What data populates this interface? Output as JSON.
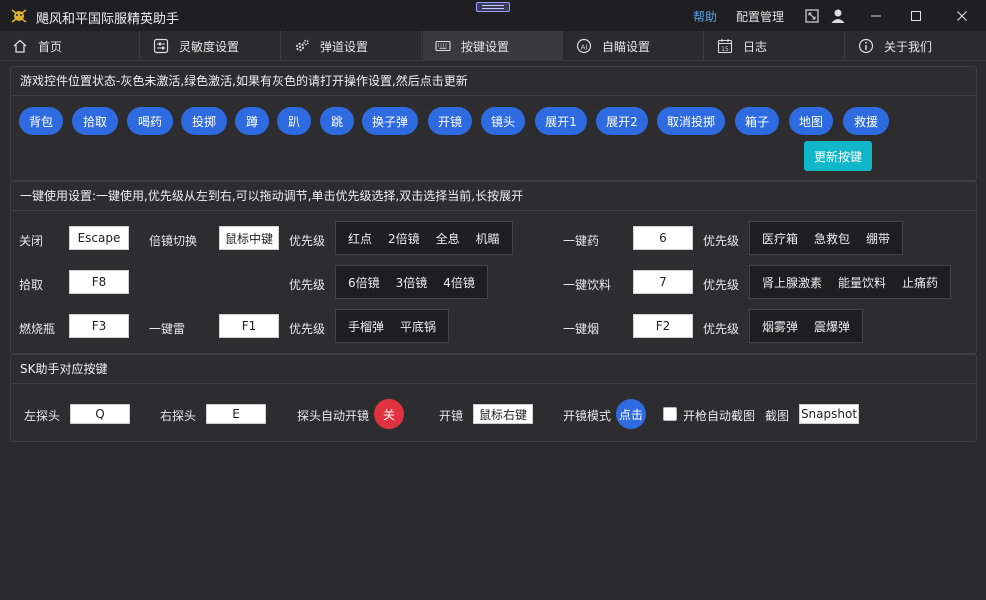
{
  "window": {
    "title": "飓风和平国际服精英助手",
    "help": "帮助",
    "config": "配置管理"
  },
  "tabs": [
    {
      "label": "首页",
      "icon": "home-icon"
    },
    {
      "label": "灵敏度设置",
      "icon": "sliders-icon"
    },
    {
      "label": "弹道设置",
      "icon": "gears-icon"
    },
    {
      "label": "按键设置",
      "icon": "keyboard-icon",
      "active": true
    },
    {
      "label": "自瞄设置",
      "icon": "ai-target-icon"
    },
    {
      "label": "日志",
      "icon": "calendar-icon"
    },
    {
      "label": "关于我们",
      "icon": "info-icon"
    }
  ],
  "control_state": {
    "title": "游戏控件位置状态-灰色未激活,绿色激活,如果有灰色的请打开操作设置,然后点击更新",
    "buttons": [
      "背包",
      "拾取",
      "喝药",
      "投掷",
      "蹲",
      "趴",
      "跳",
      "换子弹",
      "开镜",
      "镜头",
      "展开1",
      "展开2",
      "取消投掷",
      "箱子",
      "地图",
      "救援"
    ],
    "update_button": "更新按键"
  },
  "one_key": {
    "title": "一键使用设置:一键使用,优先级从左到右,可以拖动调节,单击优先级选择,双击选择当前,长按展开",
    "close_label": "关闭",
    "close_key": "Escape",
    "zoom_switch_label": "倍镜切换",
    "zoom_switch_key": "鼠标中键",
    "priority_label": "优先级",
    "scope_priority_1": [
      "红点",
      "2倍镜",
      "全息",
      "机瞄"
    ],
    "pickup_label": "拾取",
    "pickup_key": "F8",
    "scope_priority_2": [
      "6倍镜",
      "3倍镜",
      "4倍镜"
    ],
    "molotov_label": "燃烧瓶",
    "molotov_key": "F3",
    "grenade_label": "一键雷",
    "grenade_key": "F1",
    "throw_priority": [
      "手榴弹",
      "平底锅"
    ],
    "med_label": "一键药",
    "med_key": "6",
    "med_priority": [
      "医疗箱",
      "急救包",
      "绷带"
    ],
    "drink_label": "一键饮料",
    "drink_key": "7",
    "drink_priority": [
      "肾上腺激素",
      "能量饮料",
      "止痛药"
    ],
    "smoke_label": "一键烟",
    "smoke_key": "F2",
    "smoke_priority": [
      "烟雾弹",
      "震爆弹"
    ]
  },
  "sk": {
    "title": "SK助手对应按键",
    "lean_left_label": "左探头",
    "lean_left_key": "Q",
    "lean_right_label": "右探头",
    "lean_right_key": "E",
    "auto_scope_label": "探头自动开镜",
    "auto_scope_state": "关",
    "auto_scope_color": "#e0323f",
    "scope_label": "开镜",
    "scope_key": "鼠标右键",
    "scope_mode_label": "开镜模式",
    "scope_mode_state": "点击",
    "scope_mode_color": "#2f6be0",
    "auto_screenshot_label": "开枪自动截图",
    "screenshot_label": "截图",
    "screenshot_key": "Snapshot"
  },
  "colors": {
    "accent_blue": "#2f6be0",
    "update_cyan": "#10b7c9",
    "help_link": "#5aa0e6"
  }
}
